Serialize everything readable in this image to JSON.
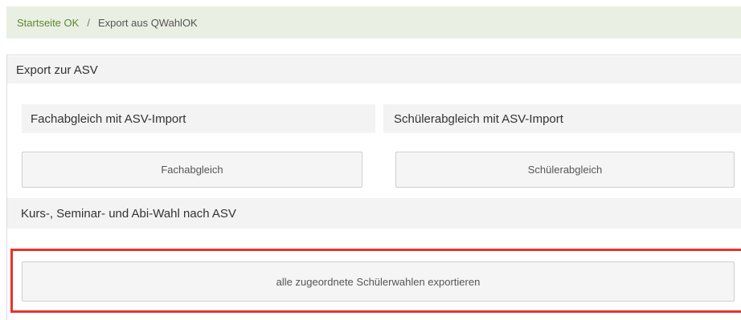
{
  "breadcrumb": {
    "home": "Startseite OK",
    "separator": "/",
    "current": "Export aus QWahlOK"
  },
  "export": {
    "title": "Export zur ASV",
    "fach": {
      "header": "Fachabgleich mit ASV-Import",
      "button": "Fachabgleich"
    },
    "schueler": {
      "header": "Schülerabgleich mit ASV-Import",
      "button": "Schülerabgleich"
    },
    "wahl": {
      "header": "Kurs-, Seminar- und Abi-Wahl nach ASV",
      "button": "alle zugeordnete Schülerwahlen exportieren"
    }
  },
  "colors": {
    "highlight": "#e8322c",
    "breadcrumb_bg": "#eaefe3",
    "link": "#5a8a2f"
  }
}
